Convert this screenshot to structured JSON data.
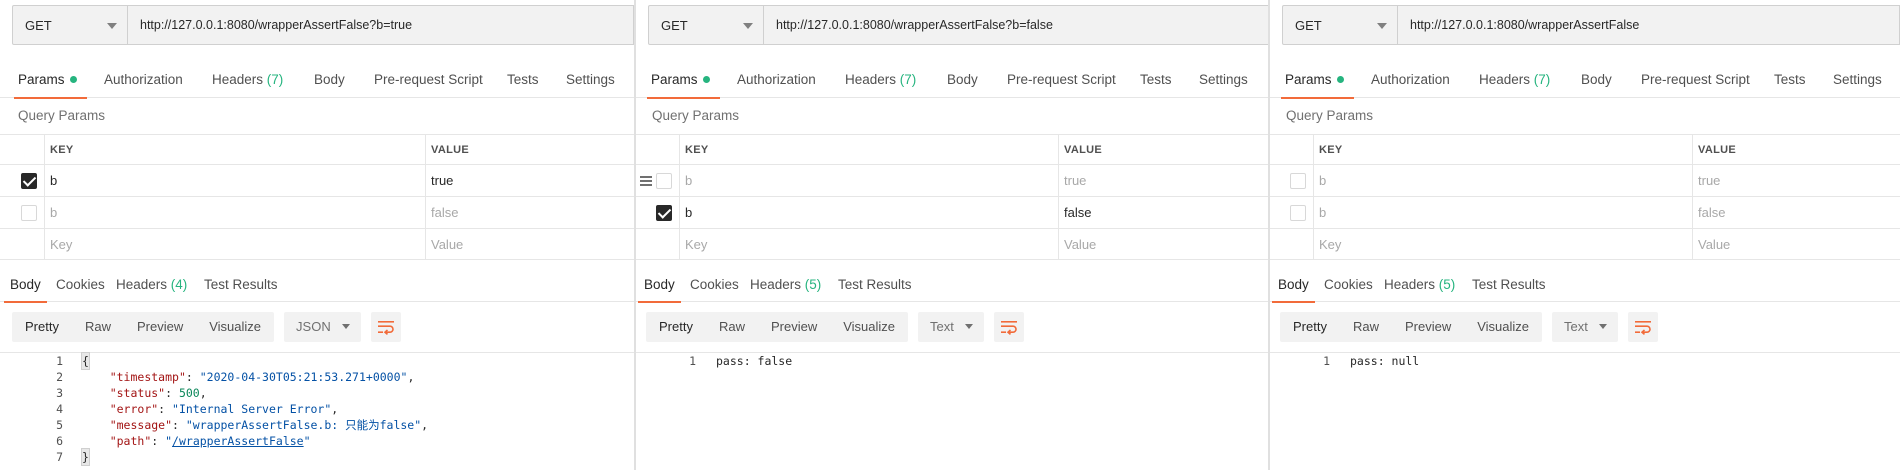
{
  "colors": {
    "accent": "#f26b3a",
    "success": "#26b47f",
    "text": "#282828",
    "muted": "#a8a8a8"
  },
  "req_tabs": [
    "Params",
    "Authorization",
    "Headers",
    "Body",
    "Pre-request Script",
    "Tests",
    "Settings"
  ],
  "headers_count": "(7)",
  "query_params_title": "Query Params",
  "col_key": "KEY",
  "col_value": "VALUE",
  "key_placeholder": "Key",
  "value_placeholder": "Value",
  "res_tabs": [
    "Body",
    "Cookies",
    "Headers",
    "Test Results"
  ],
  "format_buttons": [
    "Pretty",
    "Raw",
    "Preview",
    "Visualize"
  ],
  "panels": [
    {
      "method": "GET",
      "url": "http://127.0.0.1:8080/wrapperAssertFalse?b=true",
      "params": [
        {
          "checked": true,
          "key": "b",
          "value": "true"
        },
        {
          "checked": false,
          "key": "b",
          "value": "false"
        }
      ],
      "response_headers_count": "(4)",
      "language": "JSON",
      "code": [
        "{",
        "    \"timestamp\": \"2020-04-30T05:21:53.271+0000\",",
        "    \"status\": 500,",
        "    \"error\": \"Internal Server Error\",",
        "    \"message\": \"wrapperAssertFalse.b: 只能为false\",",
        "    \"path\": \"/wrapperAssertFalse\"",
        "}"
      ]
    },
    {
      "method": "GET",
      "url": "http://127.0.0.1:8080/wrapperAssertFalse?b=false",
      "params": [
        {
          "checked": false,
          "key": "b",
          "value": "true"
        },
        {
          "checked": true,
          "key": "b",
          "value": "false"
        }
      ],
      "response_headers_count": "(5)",
      "language": "Text",
      "code": [
        "pass: false"
      ]
    },
    {
      "method": "GET",
      "url": "http://127.0.0.1:8080/wrapperAssertFalse",
      "params": [
        {
          "checked": false,
          "key": "b",
          "value": "true"
        },
        {
          "checked": false,
          "key": "b",
          "value": "false"
        }
      ],
      "response_headers_count": "(5)",
      "language": "Text",
      "code": [
        "pass: null"
      ]
    }
  ]
}
